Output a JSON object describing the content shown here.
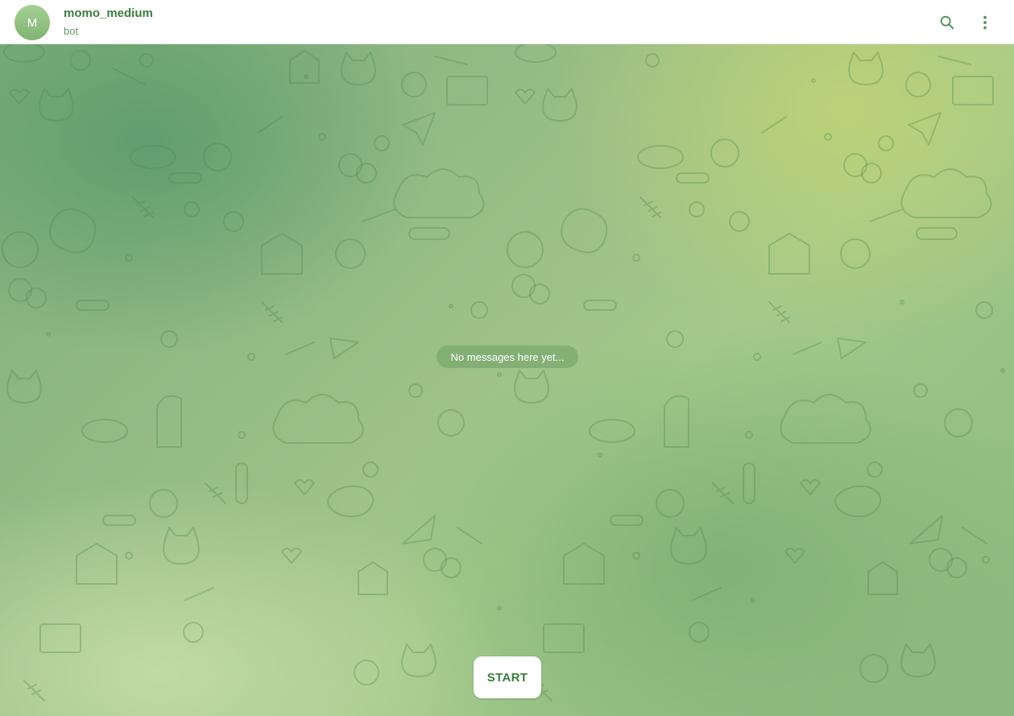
{
  "chat": {
    "avatar_letter": "M",
    "title": "momo_medium",
    "subtitle": "bot"
  },
  "header_actions": {
    "search_icon": "search-icon",
    "more_icon": "more-vertical-icon"
  },
  "empty_state": {
    "text": "No messages here yet..."
  },
  "start_button": {
    "label": "START"
  },
  "colors": {
    "accent": "#3a7d3c",
    "background_green": "#8bb980",
    "avatar": "#8fc182"
  }
}
